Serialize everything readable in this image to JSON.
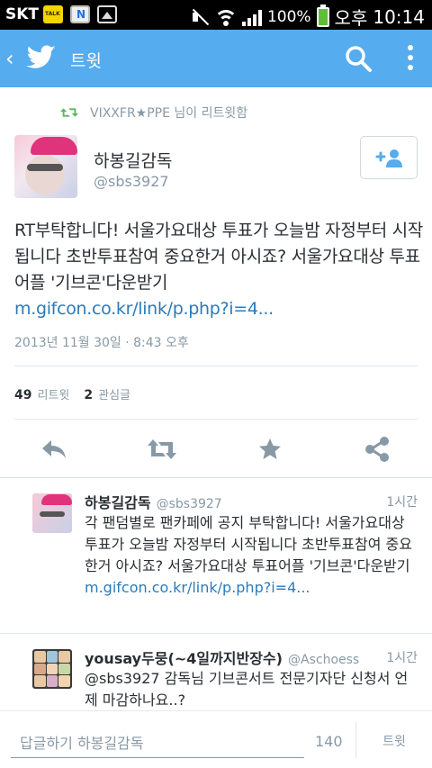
{
  "status_bar": {
    "carrier": "SKT",
    "battery": "100%",
    "ampm": "오후",
    "time": "10:14"
  },
  "app_bar": {
    "title": "트윗",
    "background": "#55acee"
  },
  "tweet": {
    "retweet_context": "VIXXFR★PPE 님이 리트윗함",
    "author_name": "하봉길감독",
    "author_handle": "@sbs3927",
    "text": "RT부탁합니다! 서울가요대상 투표가 오늘밤 자정부터 시작됩니다 초반투표참여 중요한거 아시죠? 서울가요대상 투표어플 '기브콘'다운받기",
    "link": "m.gifcon.co.kr/link/p.php?i=4...",
    "timestamp": "2013년 11월 30일 · 8:43 오후",
    "retweet_count": "49",
    "retweet_label": "리트윗",
    "favorite_count": "2",
    "favorite_label": "관심글"
  },
  "replies": [
    {
      "name": "하봉길감독",
      "handle": "@sbs3927",
      "time": "1시간",
      "text": "각 팬덤별로 팬카페에 공지 부탁합니다! 서울가요대상 투표가 오늘밤 자정부터 시작됩니다 초반투표참여 중요한거 아시죠? 서울가요대상 투표어플 '기브콘'다운받기",
      "link": "m.gifcon.co.kr/link/p.php?i=4..."
    },
    {
      "name": "yousay두뭉(~4일까지반장수)",
      "handle": "@Aschoess",
      "time": "1시간",
      "text": "@sbs3927 감독님 기브콘서트 전문기자단 신청서 언제 마감하나요..?"
    }
  ],
  "composer": {
    "placeholder": "답글하기 하봉길감독",
    "char_count": "140",
    "tweet_label": "트윗"
  },
  "icons": {
    "back": "chevron-left-icon",
    "logo": "twitter-bird-icon",
    "search": "search-icon",
    "more": "overflow-menu-icon",
    "follow": "add-user-icon",
    "reply": "reply-icon",
    "retweet": "retweet-icon",
    "favorite": "star-icon",
    "share": "share-icon"
  }
}
